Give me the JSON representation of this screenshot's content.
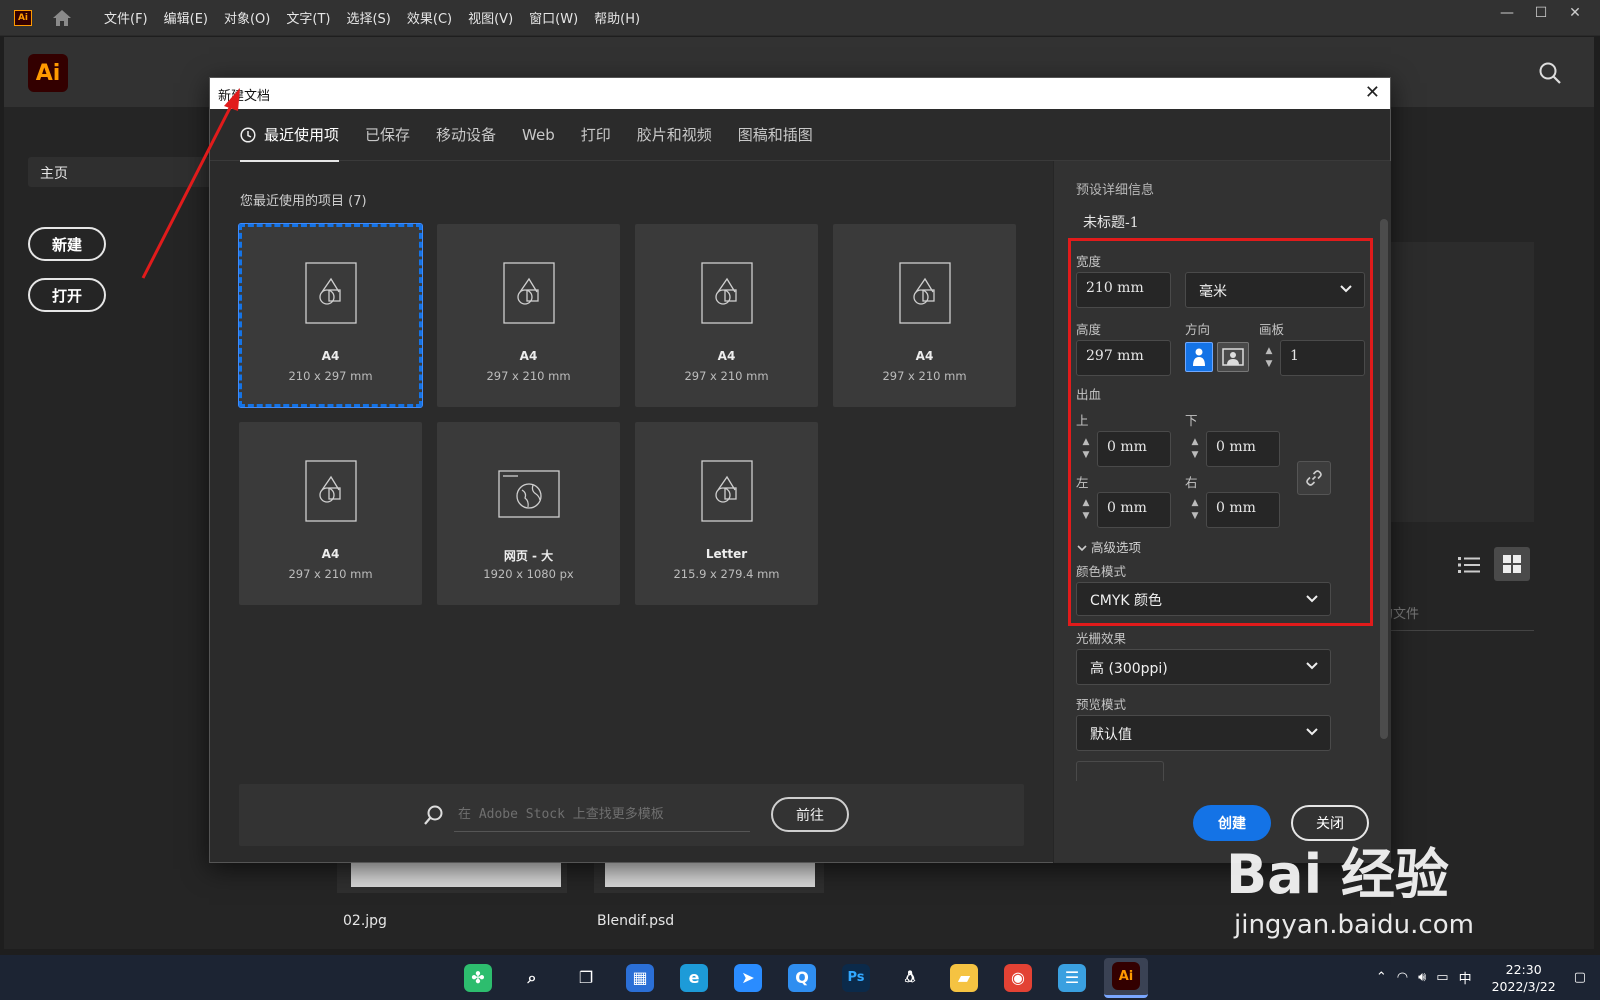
{
  "menubar": {
    "app_badge": "Ai",
    "menus": [
      "文件(F)",
      "编辑(E)",
      "对象(O)",
      "文字(T)",
      "选择(S)",
      "效果(C)",
      "视图(V)",
      "窗口(W)",
      "帮助(H)"
    ],
    "window_controls": [
      "—",
      "☐",
      "✕"
    ]
  },
  "home": {
    "logo": "Ai",
    "nav_home": "主页",
    "new_button": "新建",
    "open_button": "打开",
    "file_hint": "的文件",
    "thumbnails": [
      {
        "name": "02.jpg"
      },
      {
        "name": "Blendif.psd"
      }
    ]
  },
  "dialog": {
    "title": "新建文档",
    "close_symbol": "✕",
    "tabs": [
      "最近使用项",
      "已保存",
      "移动设备",
      "Web",
      "打印",
      "胶片和视频",
      "图稿和插图"
    ],
    "active_tab": 0,
    "recent_label": "您最近使用的项目 (7)",
    "presets": [
      {
        "name": "A4",
        "size": "210 x 297 mm",
        "icon": "document-icon",
        "selected": true
      },
      {
        "name": "A4",
        "size": "297 x 210 mm",
        "icon": "document-icon",
        "selected": false
      },
      {
        "name": "A4",
        "size": "297 x 210 mm",
        "icon": "document-icon",
        "selected": false
      },
      {
        "name": "A4",
        "size": "297 x 210 mm",
        "icon": "document-icon",
        "selected": false
      },
      {
        "name": "A4",
        "size": "297 x 210 mm",
        "icon": "document-icon",
        "selected": false
      },
      {
        "name": "网页 - 大",
        "size": "1920 x 1080 px",
        "icon": "web-icon",
        "selected": false
      },
      {
        "name": "Letter",
        "size": "215.9 x 279.4 mm",
        "icon": "document-icon",
        "selected": false
      }
    ],
    "stock": {
      "placeholder": "在 Adobe Stock 上查找更多模板",
      "go_button": "前往"
    },
    "details": {
      "section_title": "预设详细信息",
      "doc_name": "未标题-1",
      "width_label": "宽度",
      "width_value": "210 mm",
      "unit_value": "毫米",
      "height_label": "高度",
      "height_value": "297 mm",
      "orientation_label": "方向",
      "artboards_label": "画板",
      "artboards_value": "1",
      "bleed_label": "出血",
      "bleed_top_label": "上",
      "bleed_top": "0 mm",
      "bleed_bottom_label": "下",
      "bleed_bottom": "0 mm",
      "bleed_left_label": "左",
      "bleed_left": "0 mm",
      "bleed_right_label": "右",
      "bleed_right": "0 mm",
      "advanced_label": "高级选项",
      "color_mode_label": "颜色模式",
      "color_mode_value": "CMYK 颜色",
      "raster_label": "光栅效果",
      "raster_value": "高 (300ppi)",
      "preview_label": "预览模式",
      "preview_value": "默认值"
    },
    "create_button": "创建",
    "close_button": "关闭"
  },
  "watermark": {
    "brand": "Bai 经验",
    "url": "jingyan.baidu.com"
  },
  "taskbar": {
    "apps": [
      {
        "icon": "start-icon",
        "label": ""
      },
      {
        "icon": "search-icon",
        "label": ""
      },
      {
        "icon": "task-view-icon",
        "label": ""
      },
      {
        "icon": "widgets-icon",
        "label": ""
      },
      {
        "icon": "edge-icon",
        "label": ""
      },
      {
        "icon": "feishu-icon",
        "label": ""
      },
      {
        "icon": "browser-icon",
        "label": ""
      },
      {
        "icon": "photoshop-icon",
        "label": "Ps"
      },
      {
        "icon": "qq-icon",
        "label": ""
      },
      {
        "icon": "file-explorer-icon",
        "label": ""
      },
      {
        "icon": "chrome-icon",
        "label": ""
      },
      {
        "icon": "notepad-icon",
        "label": ""
      },
      {
        "icon": "illustrator-icon",
        "label": "Ai"
      }
    ],
    "tray": {
      "ime": "中",
      "time": "22:30",
      "date": "2022/3/22"
    }
  },
  "colors": {
    "accent_blue": "#1473e6",
    "annotation_red": "#e11b1b",
    "ai_orange": "#ff9a00"
  }
}
